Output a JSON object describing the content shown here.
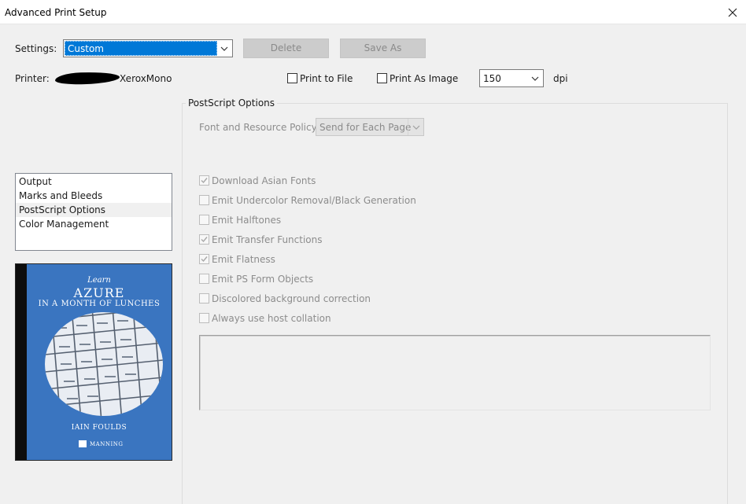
{
  "window": {
    "title": "Advanced Print Setup"
  },
  "settings": {
    "label": "Settings:",
    "value": "Custom",
    "delete_label": "Delete",
    "save_as_label": "Save As"
  },
  "printer": {
    "label": "Printer:",
    "name": "XeroxMono",
    "print_to_file_label": "Print to File",
    "print_to_file_checked": false,
    "print_as_image_label": "Print As Image",
    "print_as_image_checked": false,
    "dpi_value": "150",
    "dpi_unit": "dpi"
  },
  "nav": {
    "items": [
      {
        "label": "Output",
        "selected": false
      },
      {
        "label": "Marks and Bleeds",
        "selected": false
      },
      {
        "label": "PostScript Options",
        "selected": true
      },
      {
        "label": "Color Management",
        "selected": false
      }
    ]
  },
  "preview": {
    "learn": "Learn",
    "title": "AZURE",
    "subtitle": "IN A MONTH OF LUNCHES",
    "author": "IAIN FOULDS",
    "publisher": "MANNING"
  },
  "postscript": {
    "group_title": "PostScript Options",
    "policy_label": "Font and Resource Policy:",
    "policy_value": "Send for Each Page",
    "options": [
      {
        "label": "Download Asian Fonts",
        "checked": true
      },
      {
        "label": "Emit Undercolor Removal/Black Generation",
        "checked": false
      },
      {
        "label": "Emit Halftones",
        "checked": false
      },
      {
        "label": "Emit Transfer Functions",
        "checked": true
      },
      {
        "label": "Emit Flatness",
        "checked": true
      },
      {
        "label": "Emit PS Form Objects",
        "checked": false
      },
      {
        "label": "Discolored background correction",
        "checked": false
      },
      {
        "label": "Always use host collation",
        "checked": false
      }
    ]
  },
  "icons": {
    "close": "close-icon",
    "dropdown": "chevron-down-icon",
    "check": "checkmark-icon"
  },
  "colors": {
    "selection": "#0078d7",
    "cover": "#3a75c0"
  }
}
